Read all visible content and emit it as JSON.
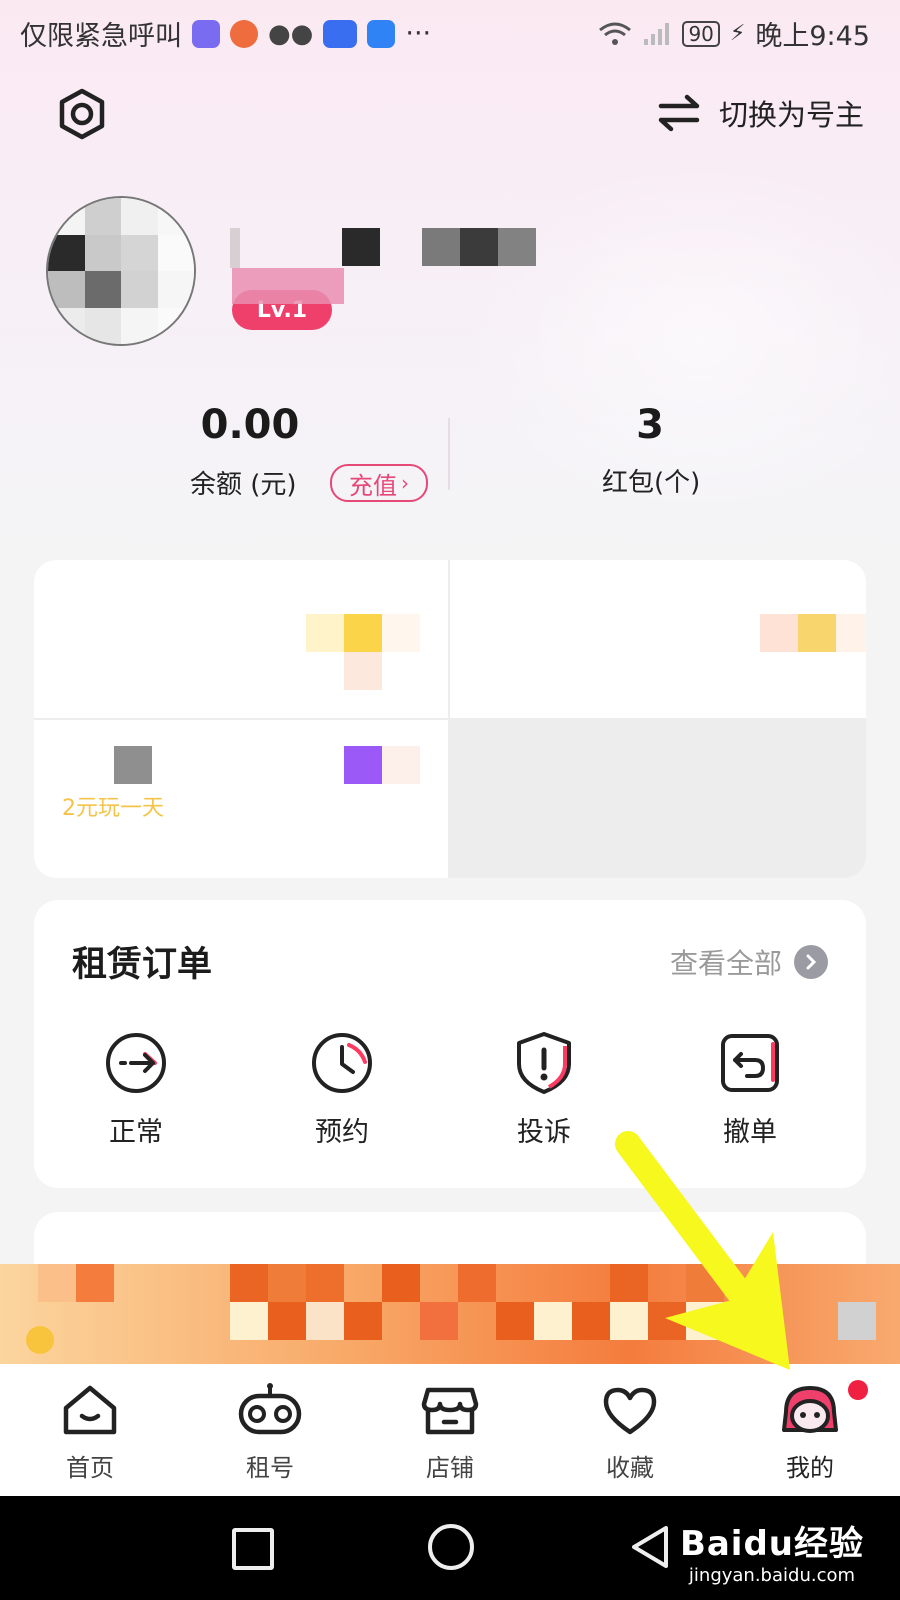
{
  "status_bar": {
    "carrier_text": "仅限紧急呼叫",
    "more": "···",
    "battery": "90",
    "time": "晚上9:45",
    "app_icons": [
      "#7a6cf0",
      "#ee6c3e",
      "#4b4b4b",
      "#3a6ef0",
      "#2f83f5"
    ]
  },
  "header": {
    "settings_icon": "hexagon-settings-icon",
    "switch_label": "切换为号主"
  },
  "profile": {
    "level": "Lv.1"
  },
  "stats": {
    "balance_value": "0.00",
    "balance_label": "余额 (元)",
    "recharge_label": "充值",
    "redpacket_value": "3",
    "redpacket_label": "红包(个)"
  },
  "promo": {
    "cell3_text": "2元玩一天",
    "accent_yellow": "#fbd449",
    "accent_purple": "#9b59f8"
  },
  "orders": {
    "title": "租赁订单",
    "view_all": "查看全部",
    "items": [
      {
        "label": "正常",
        "icon": "arrow-circle-icon"
      },
      {
        "label": "预约",
        "icon": "clock-icon"
      },
      {
        "label": "投诉",
        "icon": "shield-alert-icon"
      },
      {
        "label": "撤单",
        "icon": "undo-box-icon"
      }
    ]
  },
  "nav": {
    "items": [
      {
        "label": "首页",
        "icon": "home-icon"
      },
      {
        "label": "租号",
        "icon": "gamepad-icon"
      },
      {
        "label": "店铺",
        "icon": "store-icon"
      },
      {
        "label": "收藏",
        "icon": "heart-icon"
      },
      {
        "label": "我的",
        "icon": "avatar-icon"
      }
    ],
    "active_index": 4
  },
  "watermark": {
    "main": "Baidu经验",
    "sub": "jingyan.baidu.com"
  }
}
